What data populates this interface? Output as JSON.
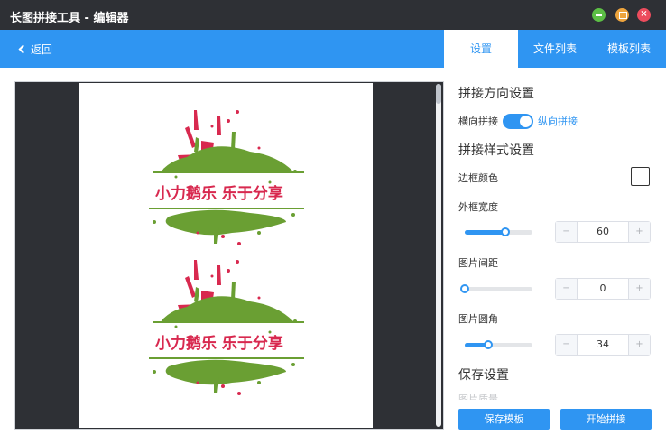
{
  "window": {
    "title": "长图拼接工具 - 编辑器",
    "buttons": {
      "minimize_icon": "minimize-icon",
      "maximize_icon": "maximize-icon",
      "close_icon": "close-icon",
      "close_glyph": "×"
    }
  },
  "topbar": {
    "back_label": "返回",
    "tabs": [
      {
        "label": "设置",
        "active": true
      },
      {
        "label": "文件列表",
        "active": false
      },
      {
        "label": "模板列表",
        "active": false
      }
    ]
  },
  "preview": {
    "images": [
      {
        "text": "小力鹅乐 乐于分享"
      },
      {
        "text": "小力鹅乐 乐于分享"
      }
    ],
    "colors": {
      "green": "#6a9f33",
      "red": "#d8294f",
      "canvas": "#2e3035"
    }
  },
  "settings": {
    "direction_title": "拼接方向设置",
    "direction_off": "横向拼接",
    "direction_on": "纵向拼接",
    "style_title": "拼接样式设置",
    "border_color_label": "边框颜色",
    "outer_width_label": "外框宽度",
    "outer_width": {
      "value": "60",
      "fraction": 0.6
    },
    "spacing_label": "图片间距",
    "spacing": {
      "value": "0",
      "fraction": 0.0
    },
    "radius_label": "图片圆角",
    "radius": {
      "value": "34",
      "fraction": 0.34
    },
    "stepper_minus": "−",
    "stepper_plus": "+",
    "save_title": "保存设置",
    "cut_label": "图片质量"
  },
  "actions": {
    "save_template": "保存模板",
    "start": "开始拼接"
  },
  "colors": {
    "accent": "#2f95f2",
    "titlebar": "#2e3035"
  }
}
